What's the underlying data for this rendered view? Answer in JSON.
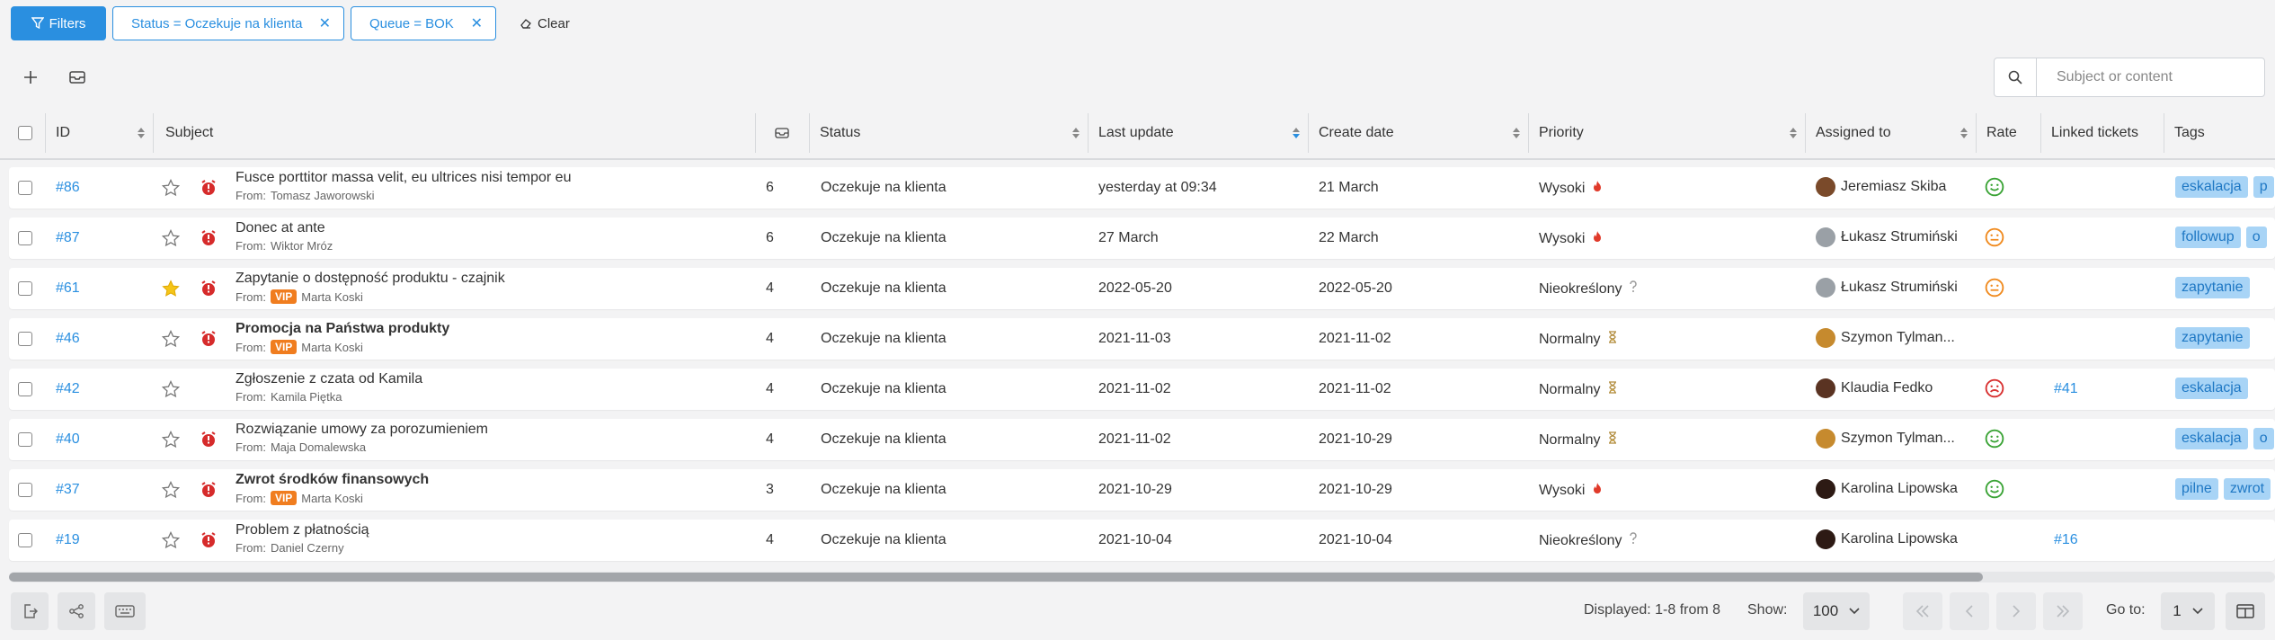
{
  "filters": {
    "button_label": "Filters",
    "chips": [
      {
        "label": "Status = Oczekuje na klienta"
      },
      {
        "label": "Queue = BOK"
      }
    ],
    "clear_label": "Clear"
  },
  "search": {
    "placeholder": "Subject or content"
  },
  "columns": {
    "id": "ID",
    "subject": "Subject",
    "status": "Status",
    "last_update": "Last update",
    "create_date": "Create date",
    "priority": "Priority",
    "assigned_to": "Assigned to",
    "rate": "Rate",
    "linked": "Linked tickets",
    "tags": "Tags"
  },
  "rows": [
    {
      "id": "#86",
      "starred": false,
      "alarm": true,
      "subject": "Fusce porttitor massa velit, eu ultrices nisi tempor eu",
      "bold": false,
      "from_label": "From:",
      "vip": "",
      "from": "Tomasz Jaworowski",
      "count": "6",
      "status": "Oczekuje na klienta",
      "last_update": "yesterday at 09:34",
      "create_date": "21 March",
      "priority": "Wysoki",
      "priority_icon": "flame-icon",
      "assignee": "Jeremiasz Skiba",
      "rate": "happy",
      "linked": "",
      "tags": [
        "eskalacja",
        "p"
      ]
    },
    {
      "id": "#87",
      "starred": false,
      "alarm": true,
      "subject": "Donec at ante",
      "bold": false,
      "from_label": "From:",
      "vip": "",
      "from": "Wiktor Mróz",
      "count": "6",
      "status": "Oczekuje na klienta",
      "last_update": "27 March",
      "create_date": "22 March",
      "priority": "Wysoki",
      "priority_icon": "flame-icon",
      "assignee": "Łukasz Strumiński",
      "rate": "neutral",
      "linked": "",
      "tags": [
        "followup",
        "o"
      ]
    },
    {
      "id": "#61",
      "starred": true,
      "alarm": true,
      "subject": "Zapytanie o dostępność produktu - czajnik",
      "bold": false,
      "from_label": "From:",
      "vip": "VIP",
      "from": "Marta Koski",
      "count": "4",
      "status": "Oczekuje na klienta",
      "last_update": "2022-05-20",
      "create_date": "2022-05-20",
      "priority": "Nieokreślony",
      "priority_icon": "question-icon",
      "assignee": "Łukasz Strumiński",
      "rate": "neutral",
      "linked": "",
      "tags": [
        "zapytanie"
      ]
    },
    {
      "id": "#46",
      "starred": false,
      "alarm": true,
      "subject": "Promocja na Państwa produkty",
      "bold": true,
      "from_label": "From:",
      "vip": "VIP",
      "from": "Marta Koski",
      "count": "4",
      "status": "Oczekuje na klienta",
      "last_update": "2021-11-03",
      "create_date": "2021-11-02",
      "priority": "Normalny",
      "priority_icon": "hourglass-icon",
      "assignee": "Szymon Tylman...",
      "rate": "",
      "linked": "",
      "tags": [
        "zapytanie"
      ]
    },
    {
      "id": "#42",
      "starred": false,
      "alarm": false,
      "subject": "Zgłoszenie z czata od Kamila",
      "bold": false,
      "from_label": "From:",
      "vip": "",
      "from": "Kamila Piętka",
      "count": "4",
      "status": "Oczekuje na klienta",
      "last_update": "2021-11-02",
      "create_date": "2021-11-02",
      "priority": "Normalny",
      "priority_icon": "hourglass-icon",
      "assignee": "Klaudia Fedko",
      "rate": "sad",
      "linked": "#41",
      "tags": [
        "eskalacja"
      ]
    },
    {
      "id": "#40",
      "starred": false,
      "alarm": true,
      "subject": "Rozwiązanie umowy za porozumieniem",
      "bold": false,
      "from_label": "From:",
      "vip": "",
      "from": "Maja Domalewska",
      "count": "4",
      "status": "Oczekuje na klienta",
      "last_update": "2021-11-02",
      "create_date": "2021-10-29",
      "priority": "Normalny",
      "priority_icon": "hourglass-icon",
      "assignee": "Szymon Tylman...",
      "rate": "happy",
      "linked": "",
      "tags": [
        "eskalacja",
        "o"
      ]
    },
    {
      "id": "#37",
      "starred": false,
      "alarm": true,
      "subject": "Zwrot środków finansowych",
      "bold": true,
      "from_label": "From:",
      "vip": "VIP",
      "from": "Marta Koski",
      "count": "3",
      "status": "Oczekuje na klienta",
      "last_update": "2021-10-29",
      "create_date": "2021-10-29",
      "priority": "Wysoki",
      "priority_icon": "flame-icon",
      "assignee": "Karolina Lipowska",
      "rate": "happy",
      "linked": "",
      "tags": [
        "pilne",
        "zwrot"
      ]
    },
    {
      "id": "#19",
      "starred": false,
      "alarm": true,
      "subject": "Problem z płatnością",
      "bold": false,
      "from_label": "From:",
      "vip": "",
      "from": "Daniel Czerny",
      "count": "4",
      "status": "Oczekuje na klienta",
      "last_update": "2021-10-04",
      "create_date": "2021-10-04",
      "priority": "Nieokreślony",
      "priority_icon": "question-icon",
      "assignee": "Karolina Lipowska",
      "rate": "",
      "linked": "#16",
      "tags": []
    }
  ],
  "footer": {
    "displayed": "Displayed: 1-8 from 8",
    "show_label": "Show:",
    "show_value": "100",
    "goto_label": "Go to:",
    "goto_value": "1"
  },
  "colors": {
    "accent": "#2a8fe0",
    "tag_bg": "#a8d4f6",
    "vip": "#f07d1f",
    "alarm": "#d62b2b",
    "happy": "#3aa335",
    "neutral": "#f08a1e",
    "sad": "#d83030"
  }
}
